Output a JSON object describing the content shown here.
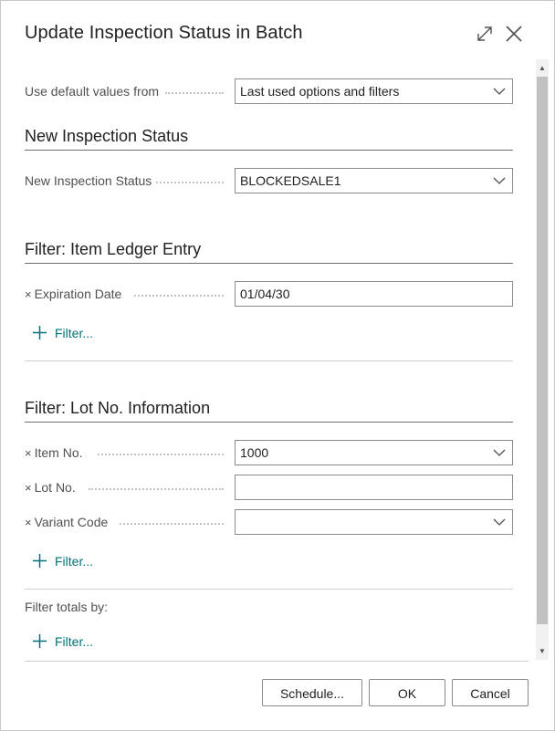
{
  "dialog": {
    "title": "Update Inspection Status in Batch"
  },
  "defaults": {
    "label": "Use default values from",
    "value": "Last used options and filters"
  },
  "section_status": {
    "title": "New Inspection Status",
    "field_label": "New Inspection Status",
    "field_value": "BLOCKEDSALE1"
  },
  "section_ile": {
    "title": "Filter: Item Ledger Entry",
    "fields": [
      {
        "remove": "×",
        "label": "Expiration Date",
        "value": "01/04/30"
      }
    ],
    "add_filter": "Filter..."
  },
  "section_lot": {
    "title": "Filter: Lot No. Information",
    "fields": [
      {
        "remove": "×",
        "label": "Item No.",
        "value": "1000"
      },
      {
        "remove": "×",
        "label": "Lot No.",
        "value": ""
      },
      {
        "remove": "×",
        "label": "Variant Code",
        "value": ""
      }
    ],
    "add_filter": "Filter..."
  },
  "totals": {
    "label": "Filter totals by:",
    "add_filter": "Filter..."
  },
  "buttons": {
    "schedule": "Schedule...",
    "ok": "OK",
    "cancel": "Cancel"
  },
  "icons": {
    "expand": "expand-icon",
    "close": "close-icon",
    "chevron": "chevron-down-icon",
    "plus": "plus-icon",
    "scroll_up": "scroll-up-icon",
    "scroll_down": "scroll-down-icon"
  },
  "colors": {
    "accent": "#00737a",
    "border": "#8a8a8a",
    "text": "#212121",
    "label": "#505050"
  }
}
